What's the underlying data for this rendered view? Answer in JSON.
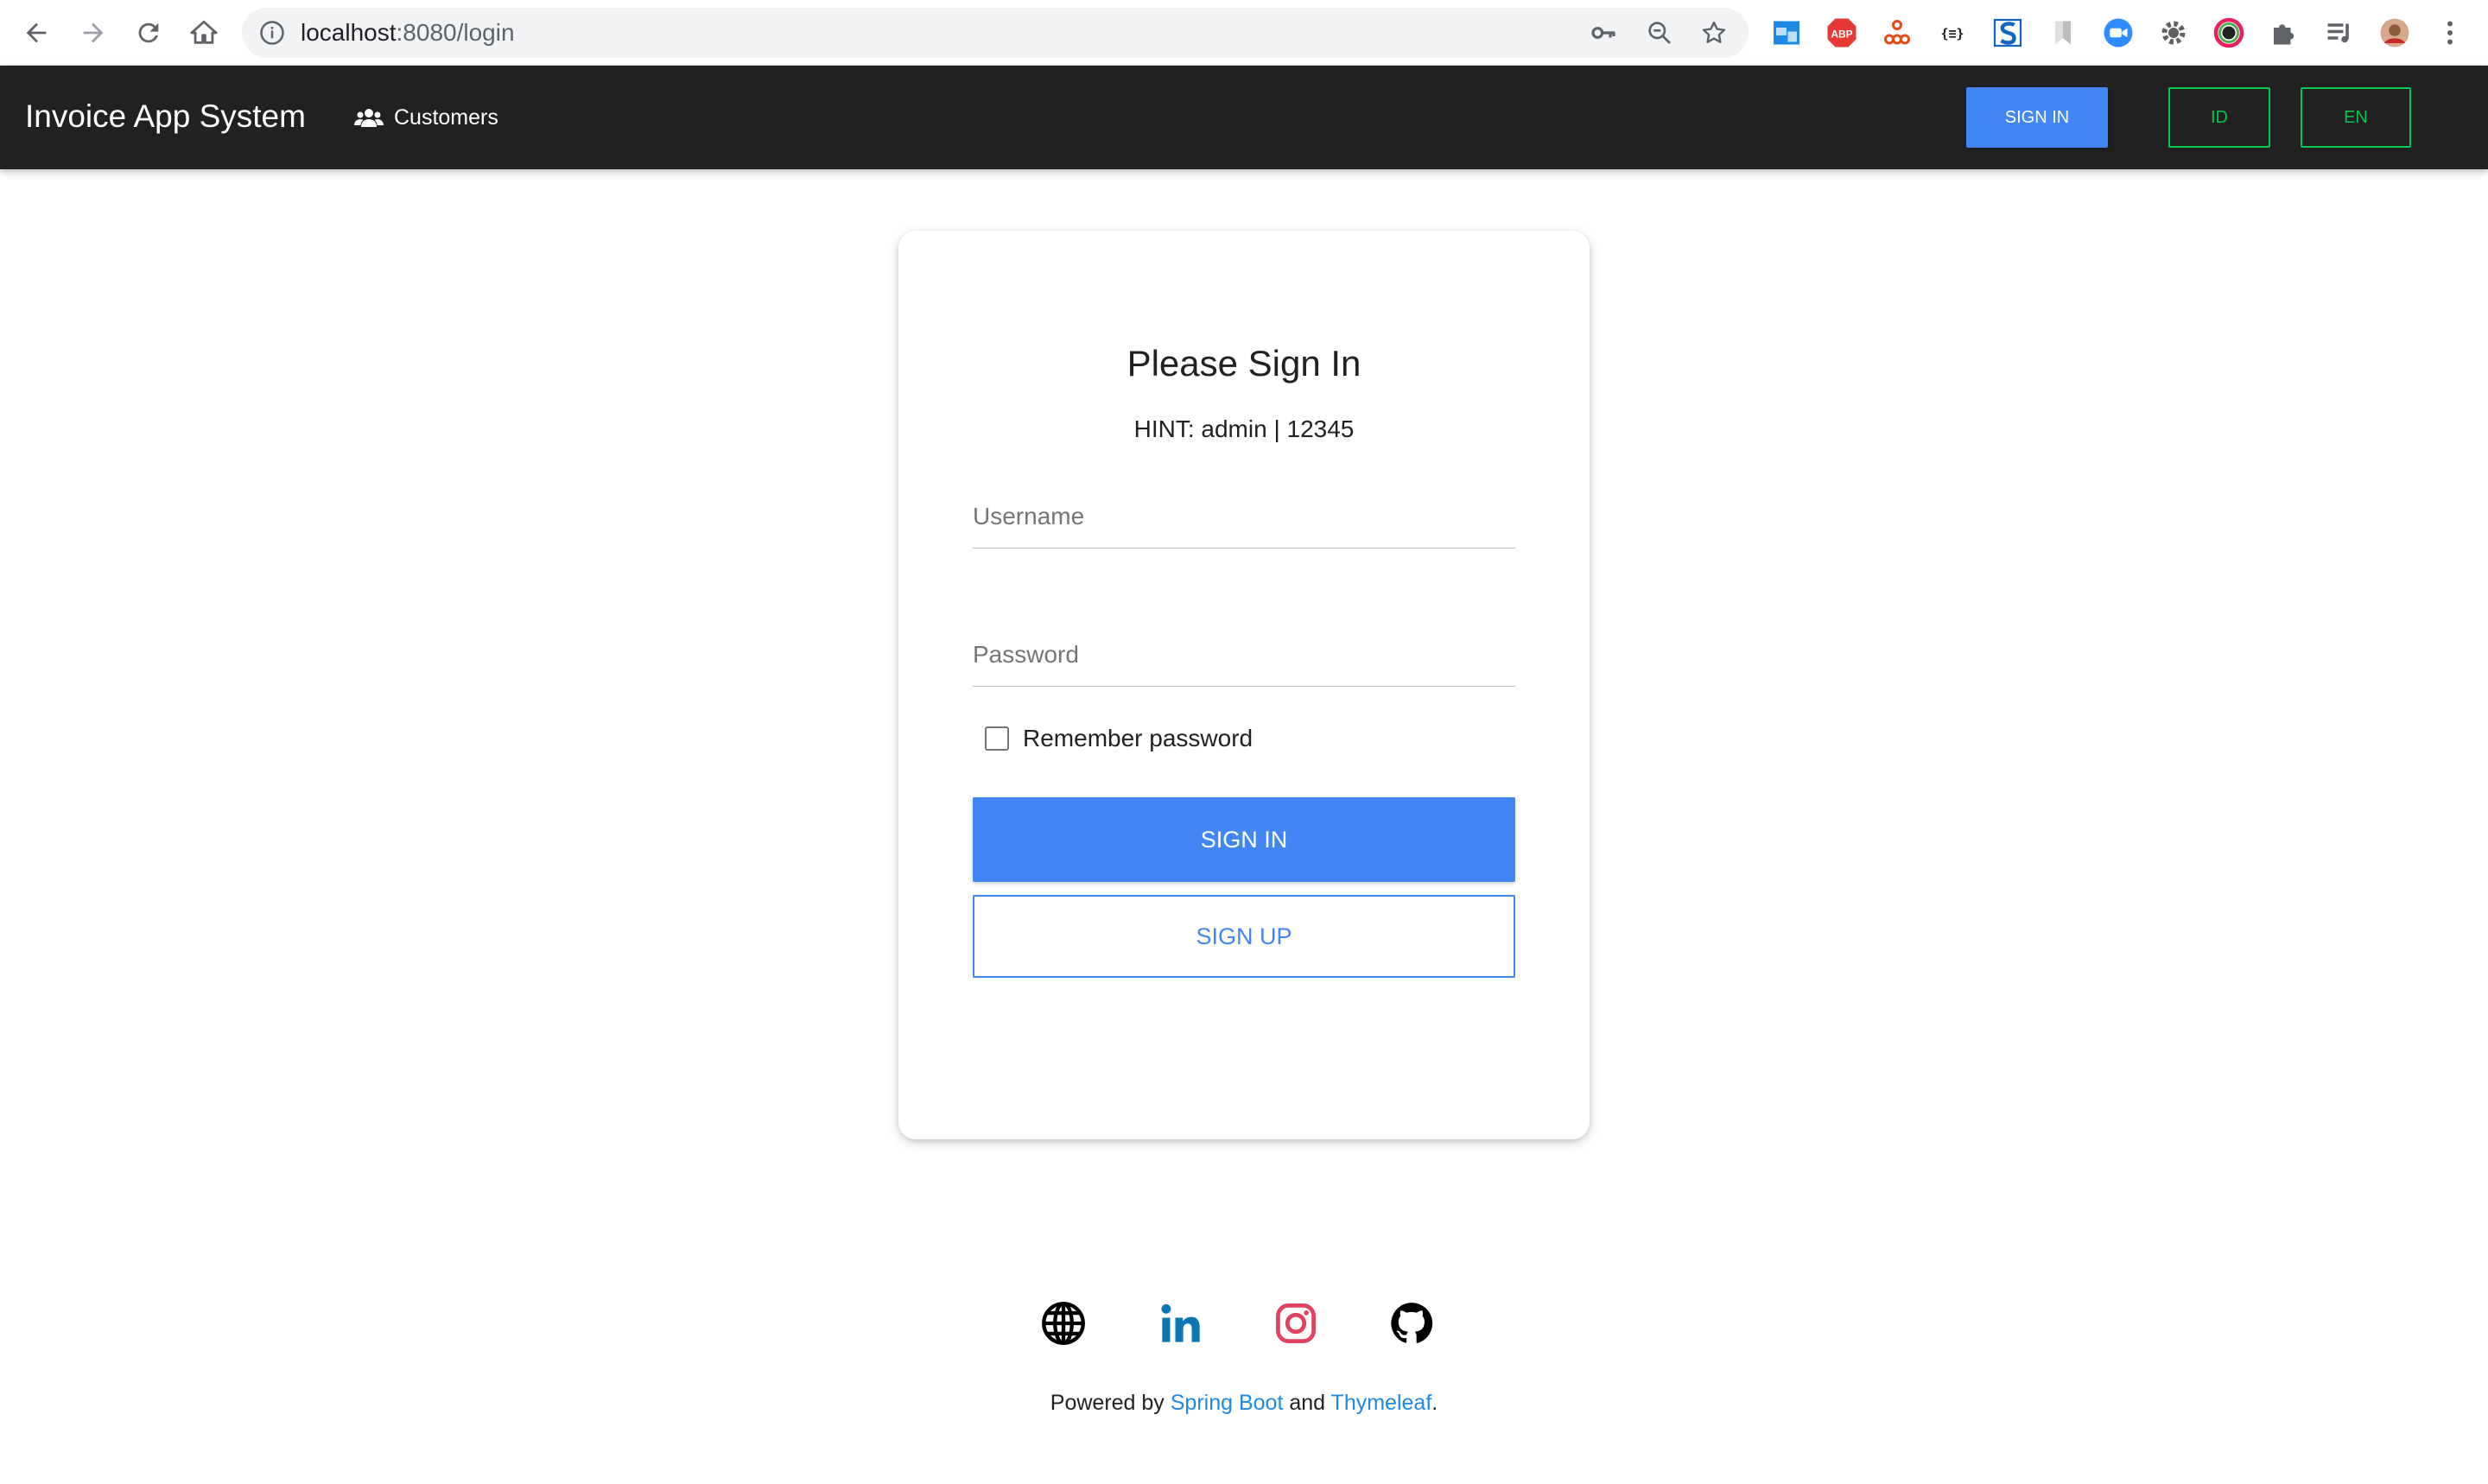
{
  "browser": {
    "url_host": "localhost",
    "url_path": ":8080/login",
    "nav_icons": [
      "back-arrow-icon",
      "forward-arrow-icon",
      "reload-icon",
      "home-icon"
    ],
    "omnibox_icons": [
      "info-icon",
      "key-icon",
      "zoom-out-icon",
      "star-icon"
    ],
    "extensions": [
      "window-ext-icon",
      "adblock-plus-icon",
      "tree-ext-icon",
      "json-ext-icon",
      "s-ext-icon",
      "bookmark-ext-icon",
      "zoom-video-icon",
      "gear-ext-icon",
      "color-picker-icon",
      "puzzle-icon",
      "media-queue-icon",
      "profile-avatar-icon",
      "kebab-menu-icon"
    ],
    "abp_label": "ABP",
    "json_label": "{≡}"
  },
  "navbar": {
    "brand": "Invoice App System",
    "customers_label": "Customers",
    "signin_label": "SIGN IN",
    "lang_id_label": "ID",
    "lang_en_label": "EN",
    "colors": {
      "background": "#212121",
      "primary": "#4285f4",
      "success": "#00c851"
    }
  },
  "login": {
    "title": "Please Sign In",
    "hint": "HINT: admin | 12345",
    "username_placeholder": "Username",
    "username_value": "",
    "password_placeholder": "Password",
    "password_value": "",
    "remember_label": "Remember password",
    "remember_checked": false,
    "signin_label": "SIGN IN",
    "signup_label": "SIGN UP"
  },
  "footer": {
    "social_icons": [
      "globe-icon",
      "linkedin-icon",
      "instagram-icon",
      "github-icon"
    ],
    "powered_prefix": "Powered by ",
    "spring_link": "Spring Boot",
    "and_text": " and ",
    "thymeleaf_link": "Thymeleaf",
    "suffix": ".",
    "colors": {
      "linkedin": "#0a77b5",
      "instagram": "#e4405f",
      "link": "#1e88e5"
    }
  }
}
